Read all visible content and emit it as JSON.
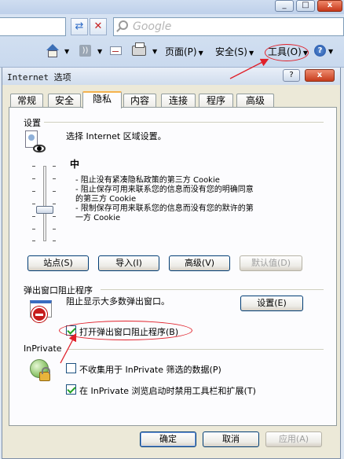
{
  "browser": {
    "search_placeholder": "Google",
    "commands": {
      "page": "页面(P)",
      "safety": "安全(S)",
      "tools": "工具(O)"
    },
    "window_buttons": [
      "_",
      "□",
      "x"
    ],
    "nav_icons": [
      "refresh-icon",
      "stop-icon"
    ]
  },
  "dialog": {
    "title": "Internet 选项",
    "help_button": "?",
    "close_button": "x",
    "tabs": [
      "常规",
      "安全",
      "隐私",
      "内容",
      "连接",
      "程序",
      "高级"
    ],
    "active_tab": "隐私",
    "settings": {
      "group_label": "设置",
      "intro": "选择 Internet 区域设置。",
      "level": "中",
      "descriptions": [
        "- 阻止没有紧凑隐私政策的第三方 Cookie",
        "- 阻止保存可用来联系您的信息而没有您的明确同意",
        "的第三方 Cookie",
        "- 限制保存可用来联系您的信息而没有您的默许的第",
        "一方 Cookie"
      ],
      "slider_level_fraction": 0.5,
      "buttons": {
        "sites": "站点(S)",
        "import": "导入(I)",
        "advanced": "高级(V)",
        "default": "默认值(D)"
      }
    },
    "popup": {
      "group_label": "弹出窗口阻止程序",
      "description": "阻止显示大多数弹出窗口。",
      "settings_button": "设置(E)",
      "enable_label": "打开弹出窗口阻止程序(B)",
      "enable_checked": true
    },
    "inprivate": {
      "group_label": "InPrivate",
      "option1_label": "不收集用于 InPrivate 筛选的数据(P)",
      "option1_checked": false,
      "option2_label": "在 InPrivate 浏览启动时禁用工具栏和扩展(T)",
      "option2_checked": true
    },
    "footer": {
      "ok": "确定",
      "cancel": "取消",
      "apply": "应用(A)"
    }
  },
  "colors": {
    "annotation": "#e0202a",
    "tab_highlight": "#f5b24e",
    "dialog_bg": "#ece9d8"
  }
}
